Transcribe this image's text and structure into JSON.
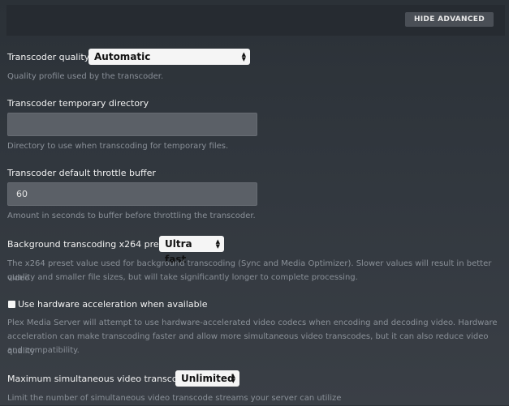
{
  "header": {
    "hide_advanced_label": "HIDE ADVANCED"
  },
  "settings": {
    "quality": {
      "label": "Transcoder quality",
      "value": "Automatic",
      "help": "Quality profile used by the transcoder."
    },
    "temp_dir": {
      "label": "Transcoder temporary directory",
      "value": "",
      "help": "Directory to use when transcoding for temporary files."
    },
    "throttle": {
      "label": "Transcoder default throttle buffer",
      "value": "60",
      "help": "Amount in seconds to buffer before throttling the transcoder."
    },
    "x264": {
      "label": "Background transcoding x264 preset",
      "value": "Ultra fast",
      "help_line1": "The x264 preset value used for background transcoding (Sync and Media Optimizer). Slower values will result in better video",
      "help_line2": "quality and smaller file sizes, but will take significantly longer to complete processing."
    },
    "hw_accel": {
      "label": "Use hardware acceleration when available",
      "checked": false,
      "help_line1": "Plex Media Server will attempt to use hardware-accelerated video codecs when encoding and decoding video. Hardware",
      "help_line2": "acceleration can make transcoding faster and allow more simultaneous video transcodes, but it can also reduce video quality",
      "help_line3": "and compatibility."
    },
    "max_transcode": {
      "label": "Maximum simultaneous video transcode",
      "value": "Unlimited",
      "help": "Limit the number of simultaneous video transcode streams your server can utilize"
    }
  }
}
